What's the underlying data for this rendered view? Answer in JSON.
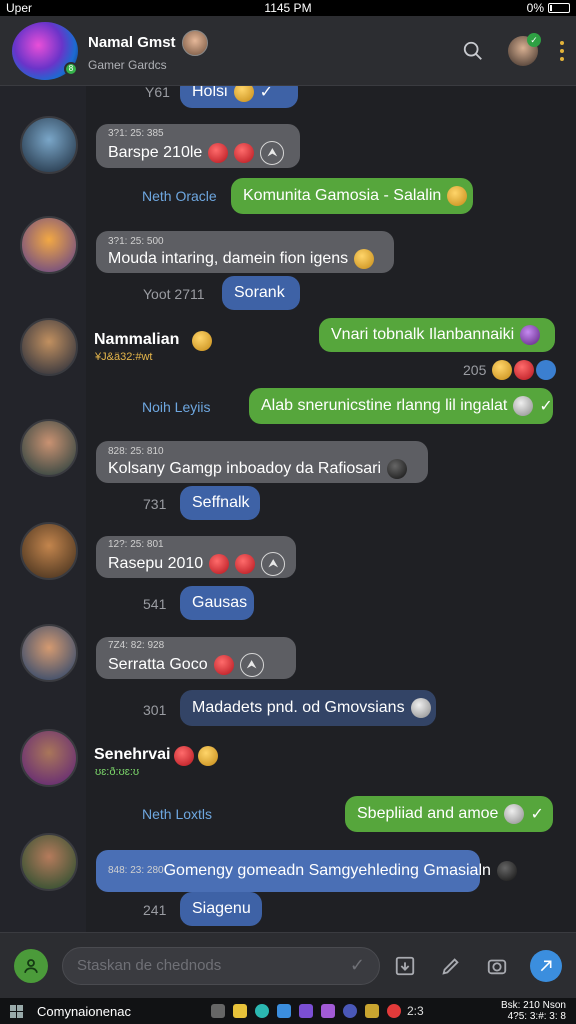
{
  "status_bar": {
    "carrier": "Uper",
    "time": "1145 PM",
    "battery": "0%"
  },
  "header": {
    "title": "Namal Gmst",
    "subtitle": "Gamer Gardcs"
  },
  "messages": [
    {
      "kind": "top_bubble",
      "timestamp": "Y61",
      "text": "Holsi"
    },
    {
      "kind": "grey",
      "meta": "3?1: 25: 385",
      "text": "Barspe 210le"
    },
    {
      "kind": "green_sent",
      "sender": "Neth Oracle",
      "text": "Komunita Gamosia - Salalin"
    },
    {
      "kind": "grey",
      "meta": "3?1: 25: 500",
      "text": "Mouda intaring, damein fion igens"
    },
    {
      "kind": "blue",
      "timestamp": "Yoot 2711",
      "text": "Sorank"
    },
    {
      "kind": "name",
      "name": "Nammalian",
      "subname": "¥J&ä32:#wt"
    },
    {
      "kind": "green_sent",
      "text": "Vnari tobnalk Ilanbannaiki",
      "footer": "205"
    },
    {
      "kind": "green_sent",
      "sender": "Noih Leyiis",
      "text": "Alab snerunicstine rlanng lil ingalat"
    },
    {
      "kind": "grey",
      "meta": "828: 25: 810",
      "text": "Kolsany Gamgp inboadoy da Rafiosari"
    },
    {
      "kind": "blue",
      "timestamp": "731",
      "text": "Seffnalk"
    },
    {
      "kind": "grey",
      "meta": "12?: 25: 801",
      "text": "Rasepu 2010"
    },
    {
      "kind": "blue",
      "timestamp": "541",
      "text": "Gausas"
    },
    {
      "kind": "grey",
      "meta": "7Z4: 82: 928",
      "text": "Serratta Goco"
    },
    {
      "kind": "bluegrey",
      "timestamp": "301",
      "text": "Madadets pnd. od Gmovsians"
    },
    {
      "kind": "name",
      "name": "Senehrvai",
      "subname": "ʊɛ:ð:ʊɛ:ʊ"
    },
    {
      "kind": "green_sent",
      "sender": "Neth Loxtls",
      "text": "Sbepliiad and amoe"
    },
    {
      "kind": "wide_blue",
      "meta": "848: 23: 280",
      "text": "Gomengy gomeadn Samgyehleding Gmasialn"
    },
    {
      "kind": "blue",
      "timestamp": "241",
      "text": "Siagenu"
    }
  ],
  "input": {
    "placeholder": "Staskan de chednods"
  },
  "taskbar": {
    "label": "Comynaionenac",
    "badge": "2:3",
    "clock_line1": "Bsk: 210 Nson",
    "clock_line2": "4?5: 3:#: 3: 8"
  },
  "icons": {
    "search": "search-icon",
    "kebab": "more-vertical-icon",
    "compass": "navigation-icon",
    "check": "check-icon",
    "user": "user-icon",
    "save": "save-icon",
    "pen": "pen-icon",
    "camera": "camera-icon",
    "send": "send-icon",
    "windows": "windows-icon"
  },
  "colors": {
    "green_bubble": "#56a63c",
    "blue_bubble": "#3e62a6",
    "grey_bubble": "#5d5e63",
    "accent": "#3b8ede"
  }
}
